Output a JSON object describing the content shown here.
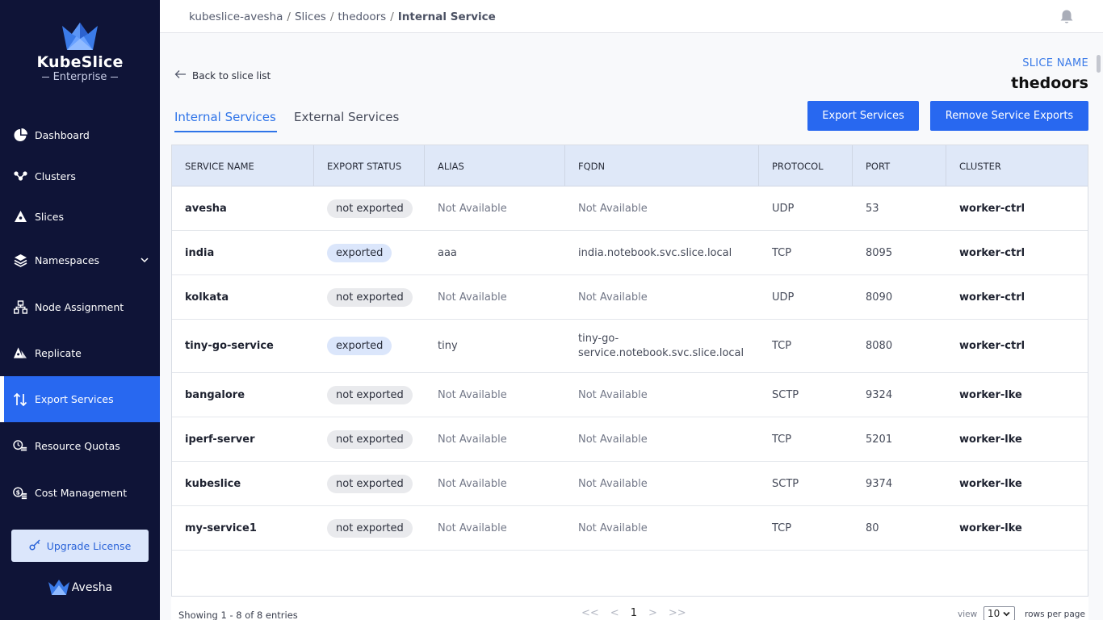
{
  "brand": {
    "title": "KubeSlice",
    "subtitle": "Enterprise",
    "footer_logo": "Avesha",
    "accent_color": "#2868f0",
    "sidebar_color": "#0f1437"
  },
  "sidebar": {
    "items": [
      {
        "label": "Dashboard",
        "icon": "pie-chart-icon"
      },
      {
        "label": "Clusters",
        "icon": "cluster-nodes-icon"
      },
      {
        "label": "Slices",
        "icon": "slice-icon"
      },
      {
        "label": "Namespaces",
        "icon": "layers-icon"
      },
      {
        "label": "Node Assignment",
        "icon": "hierarchy-icon"
      },
      {
        "label": "Replicate",
        "icon": "replicate-icon"
      },
      {
        "label": "Export Services",
        "icon": "arrows-up-down-icon"
      },
      {
        "label": "Resource Quotas",
        "icon": "quota-icon"
      },
      {
        "label": "Cost Management",
        "icon": "coins-icon"
      }
    ],
    "active": "Export Services",
    "upgrade_label": "Upgrade License"
  },
  "breadcrumb": {
    "items": [
      "kubeslice-avesha",
      "Slices",
      "thedoors"
    ],
    "current": "Internal Service",
    "separator": "/"
  },
  "header": {
    "back_label": "Back to slice list",
    "slice_label": "SLICE NAME",
    "slice_name": "thedoors"
  },
  "tabs": {
    "internal": "Internal Services",
    "external": "External Services",
    "active": "Internal Services"
  },
  "actions": {
    "export": "Export Services",
    "remove": "Remove Service Exports"
  },
  "table": {
    "columns": [
      "SERVICE NAME",
      "EXPORT STATUS",
      "ALIAS",
      "FQDN",
      "PROTOCOL",
      "PORT",
      "CLUSTER"
    ],
    "rows": [
      {
        "name": "avesha",
        "status": "not exported",
        "alias": "Not Available",
        "fqdn": "Not Available",
        "protocol": "UDP",
        "port": "53",
        "cluster": "worker-ctrl"
      },
      {
        "name": "india",
        "status": "exported",
        "alias": "aaa",
        "fqdn": "india.notebook.svc.slice.local",
        "protocol": "TCP",
        "port": "8095",
        "cluster": "worker-ctrl"
      },
      {
        "name": "kolkata",
        "status": "not exported",
        "alias": "Not Available",
        "fqdn": "Not Available",
        "protocol": "UDP",
        "port": "8090",
        "cluster": "worker-ctrl"
      },
      {
        "name": "tiny-go-service",
        "status": "exported",
        "alias": "tiny",
        "fqdn": "tiny-go-service.notebook.svc.slice.local",
        "fqdn_line1": "tiny-go-",
        "fqdn_line2": "service.notebook.svc.slice.local",
        "protocol": "TCP",
        "port": "8080",
        "cluster": "worker-ctrl"
      },
      {
        "name": "bangalore",
        "status": "not exported",
        "alias": "Not Available",
        "fqdn": "Not Available",
        "protocol": "SCTP",
        "port": "9324",
        "cluster": "worker-lke"
      },
      {
        "name": "iperf-server",
        "status": "not exported",
        "alias": "Not Available",
        "fqdn": "Not Available",
        "protocol": "TCP",
        "port": "5201",
        "cluster": "worker-lke"
      },
      {
        "name": "kubeslice",
        "status": "not exported",
        "alias": "Not Available",
        "fqdn": "Not Available",
        "protocol": "SCTP",
        "port": "9374",
        "cluster": "worker-lke"
      },
      {
        "name": "my-service1",
        "status": "not exported",
        "alias": "Not Available",
        "fqdn": "Not Available",
        "protocol": "TCP",
        "port": "80",
        "cluster": "worker-lke"
      }
    ]
  },
  "pagination": {
    "showing": "Showing 1 - 8 of 8 entries",
    "first": "<<",
    "prev": "<",
    "current_page": "1",
    "next": ">",
    "last": ">>",
    "view_label": "view",
    "rows_per_page_value": "10",
    "rows_per_page_label": "rows per page"
  }
}
